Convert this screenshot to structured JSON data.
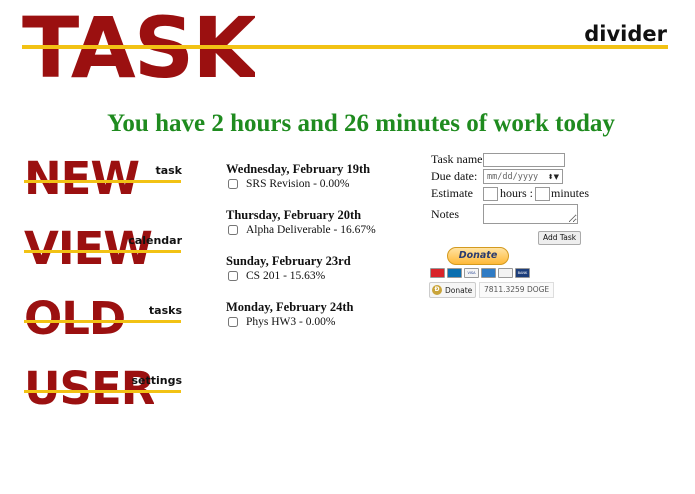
{
  "header": {
    "logo_text": "TASK",
    "logo_subtext": "divider"
  },
  "headline": "You have 2 hours and 26 minutes of work today",
  "nav": {
    "items": [
      {
        "big": "NEW",
        "small": "task"
      },
      {
        "big": "VIEW",
        "small": "calendar"
      },
      {
        "big": "OLD",
        "small": "tasks"
      },
      {
        "big": "USER",
        "small": "settings"
      }
    ]
  },
  "tasks": {
    "groups": [
      {
        "date": "Wednesday, February 19th",
        "items": [
          {
            "label": "SRS Revision - 0.00%"
          }
        ]
      },
      {
        "date": "Thursday, February 20th",
        "items": [
          {
            "label": "Alpha Deliverable - 16.67%"
          }
        ]
      },
      {
        "date": "Sunday, February 23rd",
        "items": [
          {
            "label": "CS 201 - 15.63%"
          }
        ]
      },
      {
        "date": "Monday, February 24th",
        "items": [
          {
            "label": "Phys HW3 - 0.00%"
          }
        ]
      }
    ]
  },
  "form": {
    "task_name_label": "Task name:",
    "task_name_value": "",
    "due_date_label": "Due date:",
    "due_date_placeholder": "mm/dd/yyyy",
    "estimate_label": "Estimate",
    "hours_label": "hours :",
    "minutes_label": "minutes",
    "notes_label": "Notes",
    "add_button": "Add Task"
  },
  "donate": {
    "paypal_label": "Donate",
    "cards": [
      "MasterCard",
      "Maestro",
      "VISA",
      "AMEX",
      "Discover",
      "BANK"
    ],
    "doge_button": "Donate",
    "doge_coin_symbol": "Ð",
    "doge_amount": "7811.3259 DOGE"
  },
  "colors": {
    "logo_red": "#9b1010",
    "accent_yellow": "#f2c214",
    "headline_green": "#1f8b1f"
  }
}
